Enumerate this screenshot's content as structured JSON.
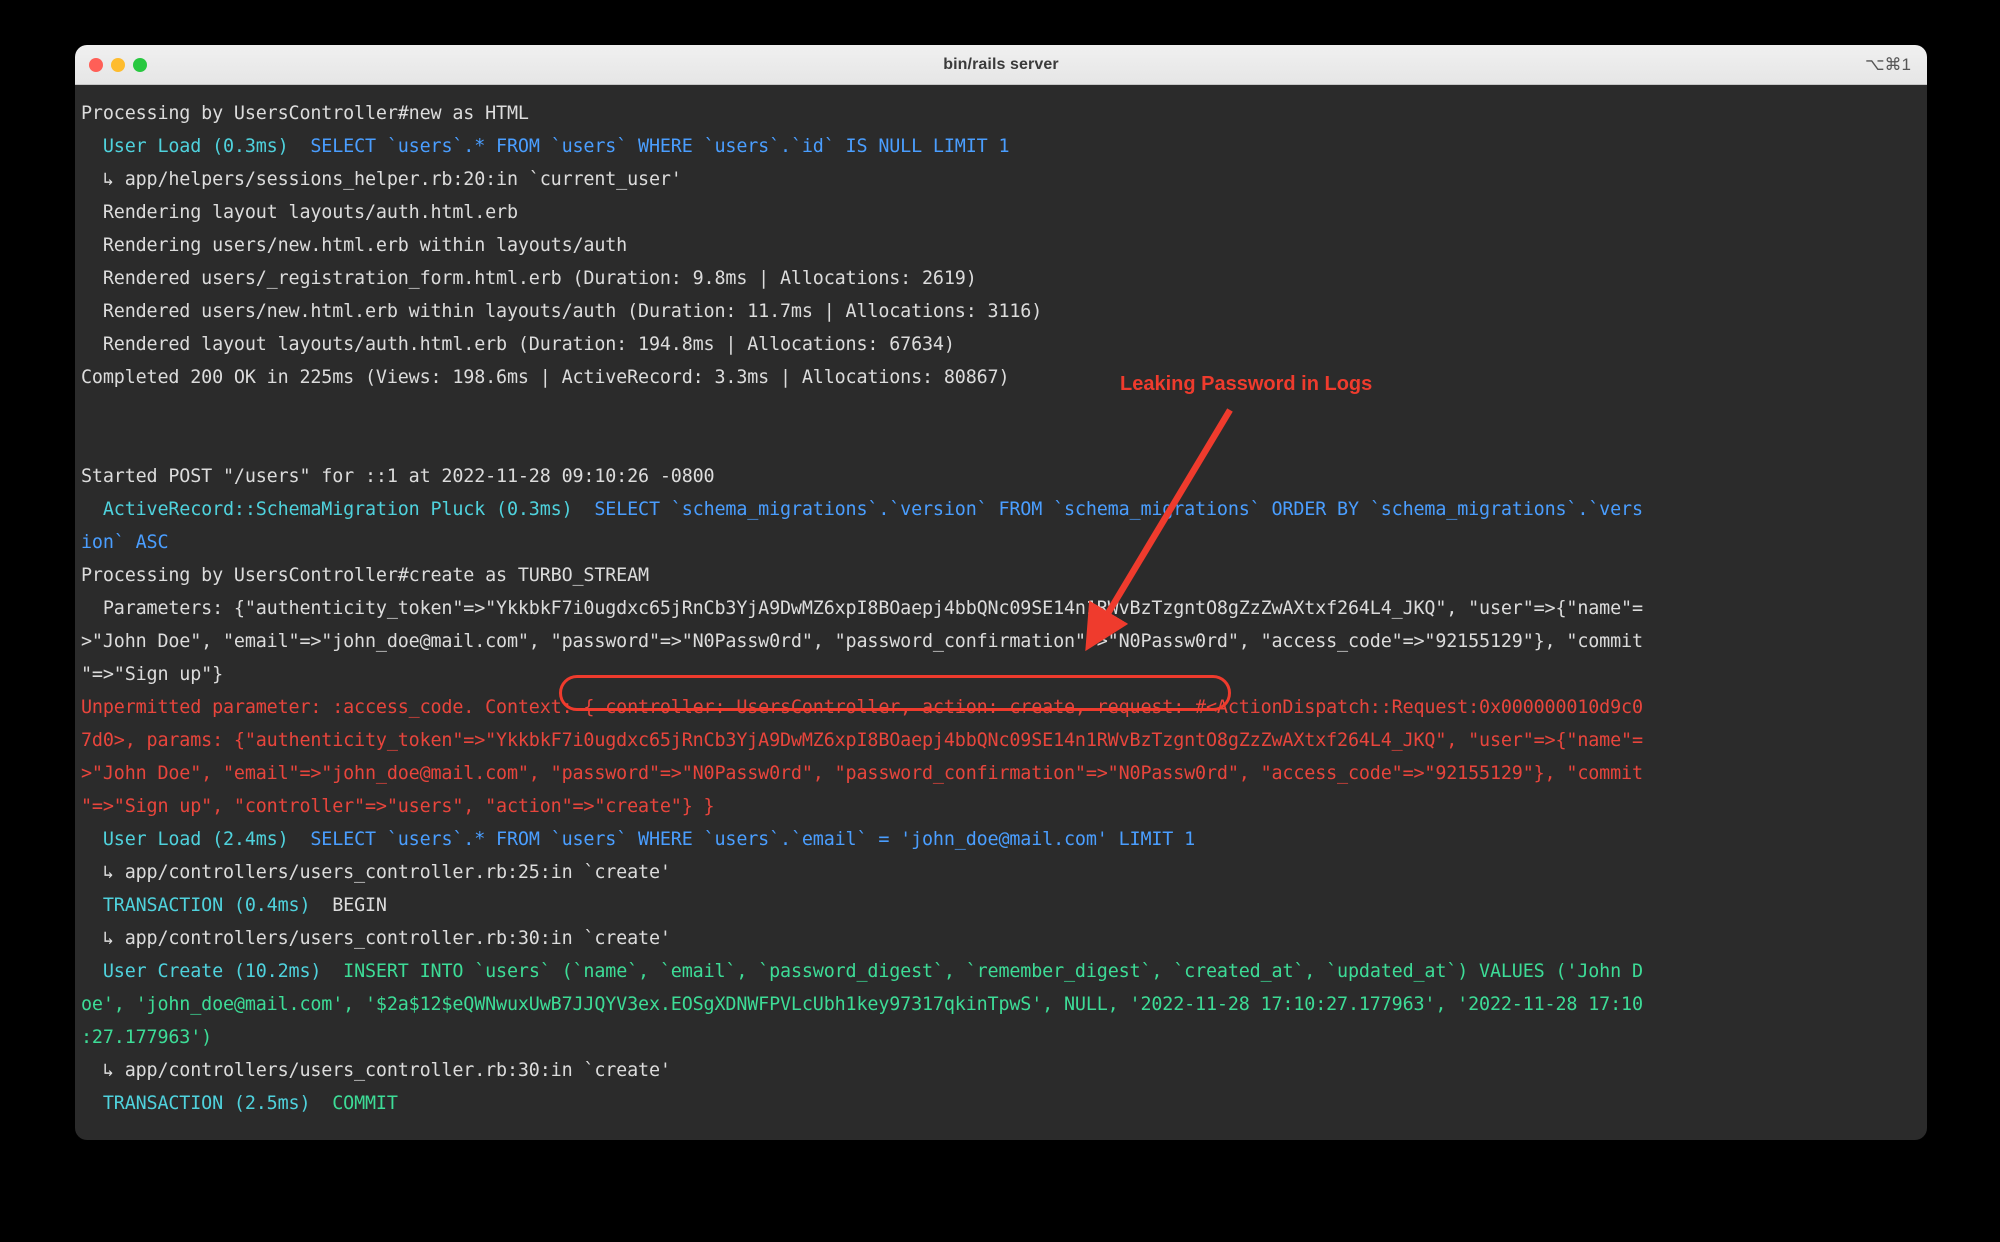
{
  "window": {
    "title": "bin/rails server",
    "shortcut": "⌥⌘1",
    "traffic_lights": [
      "close-red",
      "minimize-yellow",
      "zoom-green"
    ]
  },
  "annotation": {
    "label": "Leaking Password in Logs",
    "color": "#ef3b2d",
    "arrow": "red-arrow-down-left",
    "highlight": "rounded-rect-outline"
  },
  "theme": {
    "background": "#2b2b2b",
    "plain": "#dcdcdc",
    "cyan": "#4fd2dd",
    "blue": "#4a9eff",
    "green": "#3ddc97",
    "magenta": "#d47fd4",
    "red": "#e8453c"
  },
  "terminal": {
    "lines": [
      {
        "segments": [
          {
            "t": "Processing by UsersController#new as HTML",
            "c": "plain"
          }
        ]
      },
      {
        "segments": [
          {
            "t": "  User Load (0.3ms)",
            "c": "cyan"
          },
          {
            "t": "  SELECT `users`.* FROM `users` WHERE `users`.`id` IS NULL LIMIT 1",
            "c": "blue"
          }
        ]
      },
      {
        "segments": [
          {
            "t": "  ↳ app/helpers/sessions_helper.rb:20:in `current_user'",
            "c": "plain"
          }
        ]
      },
      {
        "segments": [
          {
            "t": "  Rendering layout layouts/auth.html.erb",
            "c": "plain"
          }
        ]
      },
      {
        "segments": [
          {
            "t": "  Rendering users/new.html.erb within layouts/auth",
            "c": "plain"
          }
        ]
      },
      {
        "segments": [
          {
            "t": "  Rendered users/_registration_form.html.erb (Duration: 9.8ms | Allocations: 2619)",
            "c": "plain"
          }
        ]
      },
      {
        "segments": [
          {
            "t": "  Rendered users/new.html.erb within layouts/auth (Duration: 11.7ms | Allocations: 3116)",
            "c": "plain"
          }
        ]
      },
      {
        "segments": [
          {
            "t": "  Rendered layout layouts/auth.html.erb (Duration: 194.8ms | Allocations: 67634)",
            "c": "plain"
          }
        ]
      },
      {
        "segments": [
          {
            "t": "Completed 200 OK in 225ms (Views: 198.6ms | ActiveRecord: 3.3ms | Allocations: 80867)",
            "c": "plain"
          }
        ]
      },
      {
        "segments": [
          {
            "t": " ",
            "c": "plain"
          }
        ]
      },
      {
        "segments": [
          {
            "t": " ",
            "c": "plain"
          }
        ]
      },
      {
        "segments": [
          {
            "t": "Started POST \"/users\" for ::1 at 2022-11-28 09:10:26 -0800",
            "c": "plain"
          }
        ]
      },
      {
        "segments": [
          {
            "t": "  ActiveRecord::SchemaMigration Pluck (0.3ms)",
            "c": "cyan"
          },
          {
            "t": "  SELECT `schema_migrations`.`version` FROM `schema_migrations` ORDER BY `schema_migrations`.`vers",
            "c": "blue"
          }
        ]
      },
      {
        "segments": [
          {
            "t": "ion` ASC",
            "c": "blue"
          }
        ]
      },
      {
        "segments": [
          {
            "t": "Processing by UsersController#create as TURBO_STREAM",
            "c": "plain"
          }
        ]
      },
      {
        "segments": [
          {
            "t": "  Parameters: {\"authenticity_token\"=>\"YkkbkF7i0ugdxc65jRnCb3YjA9DwMZ6xpI8BOaepj4bbQNc09SE14n1RWvBzTzgntO8gZzZwAXtxf264L4_JKQ\", \"user\"=>{\"name\"=",
            "c": "plain"
          }
        ]
      },
      {
        "segments": [
          {
            "t": ">\"John Doe\", \"email\"=>\"john_doe@mail.com\", \"password\"=>\"N0Passw0rd\", \"password_confirmation\"=>\"N0Passw0rd\", \"access_code\"=>\"92155129\"}, \"commit",
            "c": "plain"
          }
        ]
      },
      {
        "segments": [
          {
            "t": "\"=>\"Sign up\"}",
            "c": "plain"
          }
        ]
      },
      {
        "segments": [
          {
            "t": "Unpermitted parameter: :access_code. Context: { controller: UsersController, action: create, request: #<ActionDispatch::Request:0x000000010d9c0",
            "c": "red"
          }
        ]
      },
      {
        "segments": [
          {
            "t": "7d0>, params: {\"authenticity_token\"=>\"YkkbkF7i0ugdxc65jRnCb3YjA9DwMZ6xpI8BOaepj4bbQNc09SE14n1RWvBzTzgntO8gZzZwAXtxf264L4_JKQ\", \"user\"=>{\"name\"=",
            "c": "red"
          }
        ]
      },
      {
        "segments": [
          {
            "t": ">\"John Doe\", \"email\"=>\"john_doe@mail.com\", \"password\"=>\"N0Passw0rd\", \"password_confirmation\"=>\"N0Passw0rd\", \"access_code\"=>\"92155129\"}, \"commit",
            "c": "red"
          }
        ]
      },
      {
        "segments": [
          {
            "t": "\"=>\"Sign up\", \"controller\"=>\"users\", \"action\"=>\"create\"} }",
            "c": "red"
          }
        ]
      },
      {
        "segments": [
          {
            "t": "  User Load (2.4ms)",
            "c": "cyan"
          },
          {
            "t": "  SELECT `users`.* FROM `users` WHERE `users`.`email` = 'john_doe@mail.com' LIMIT 1",
            "c": "blue"
          }
        ]
      },
      {
        "segments": [
          {
            "t": "  ↳ app/controllers/users_controller.rb:25:in `create'",
            "c": "plain"
          }
        ]
      },
      {
        "segments": [
          {
            "t": "  TRANSACTION (0.4ms)",
            "c": "cyan"
          },
          {
            "t": "  BEGIN",
            "c": "magenta"
          }
        ]
      },
      {
        "segments": [
          {
            "t": "  ↳ app/controllers/users_controller.rb:30:in `create'",
            "c": "plain"
          }
        ]
      },
      {
        "segments": [
          {
            "t": "  User Create (10.2ms)",
            "c": "cyan"
          },
          {
            "t": "  INSERT INTO `users` (`name`, `email`, `password_digest`, `remember_digest`, `created_at`, `updated_at`) VALUES ('John D",
            "c": "green"
          }
        ]
      },
      {
        "segments": [
          {
            "t": "oe', 'john_doe@mail.com', '$2a$12$eQWNwuxUwB7JJQYV3ex.EOSgXDNWFPVLcUbh1key97317qkinTpwS', NULL, '2022-11-28 17:10:27.177963', '2022-11-28 17:10",
            "c": "green"
          }
        ]
      },
      {
        "segments": [
          {
            "t": ":27.177963')",
            "c": "green"
          }
        ]
      },
      {
        "segments": [
          {
            "t": "  ↳ app/controllers/users_controller.rb:30:in `create'",
            "c": "plain"
          }
        ]
      },
      {
        "segments": [
          {
            "t": "  TRANSACTION (2.5ms)",
            "c": "cyan"
          },
          {
            "t": "  COMMIT",
            "c": "green"
          }
        ]
      }
    ]
  }
}
